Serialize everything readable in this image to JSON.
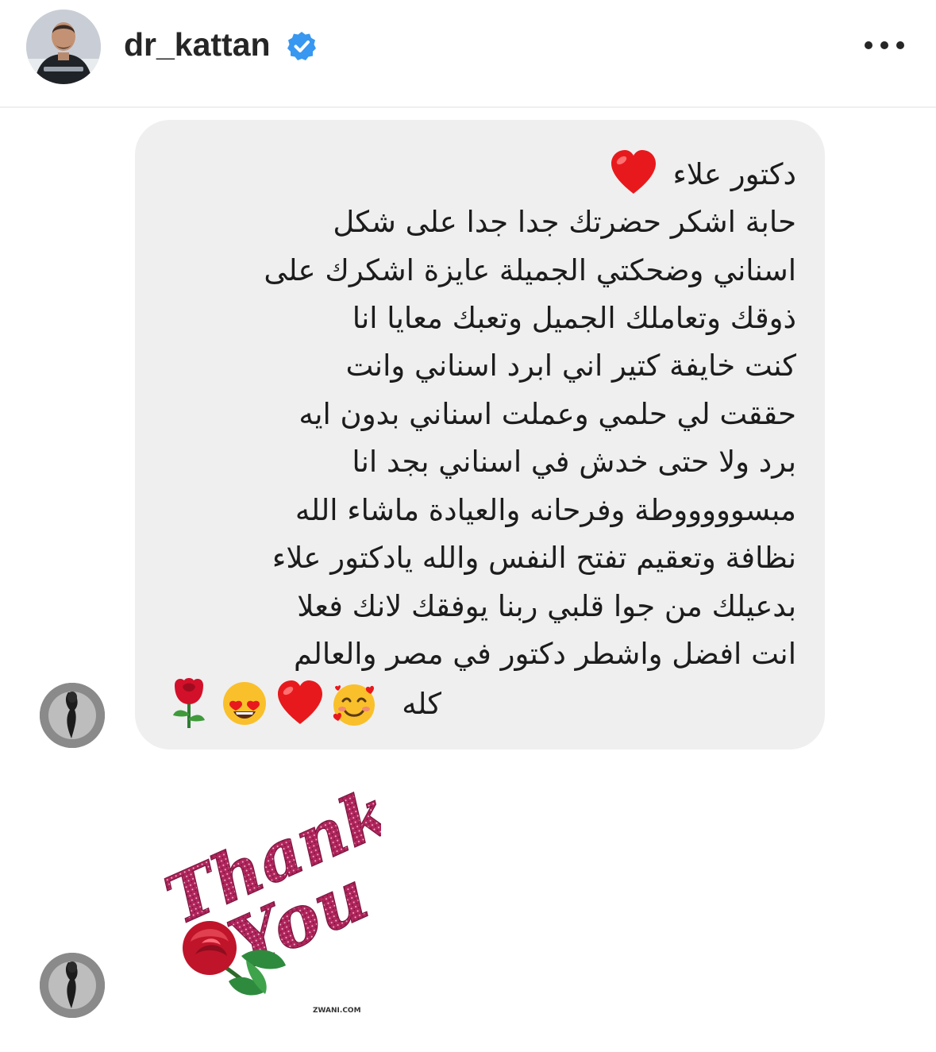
{
  "header": {
    "username": "dr_kattan",
    "avatar_icon": "profile-photo",
    "verified_icon": "verified-badge-icon",
    "more_icon": "more-options-icon"
  },
  "message": {
    "greeting": "دكتور علاء",
    "greeting_emoji": "heart-emoji",
    "lines": [
      "حابة اشكر حضرتك جدا جدا على شكل",
      "اسناني وضحكتي الجميلة عايزة اشكرك على",
      "ذوقك وتعاملك الجميل وتعبك معايا انا",
      "كنت خايفة كتير اني ابرد اسناني وانت",
      "حققت لي حلمي وعملت اسناني بدون ايه",
      "برد ولا حتى خدش في اسناني بجد انا",
      "مبسوووووطة وفرحانه والعيادة ماشاء الله",
      "نظافة وتعقيم تفتح النفس والله يادكتور علاء",
      "بدعيلك من جوا قلبي ربنا يوفقك لانك فعلا",
      "انت افضل واشطر دكتور في مصر والعالم"
    ],
    "closing": "كله",
    "closing_emojis": [
      "smiling-face-with-hearts",
      "heart",
      "heart-eyes",
      "rose"
    ]
  },
  "sticker": {
    "text_line1": "Thank",
    "text_line2": "You",
    "watermark": "ZWANI.COM",
    "colors": {
      "glitter": "#b0255c",
      "rose": "#c0142a",
      "leaf": "#2e7d32"
    }
  },
  "colors": {
    "bubble": "#efefef",
    "verified": "#3897f0",
    "text": "#1c1c1c"
  }
}
